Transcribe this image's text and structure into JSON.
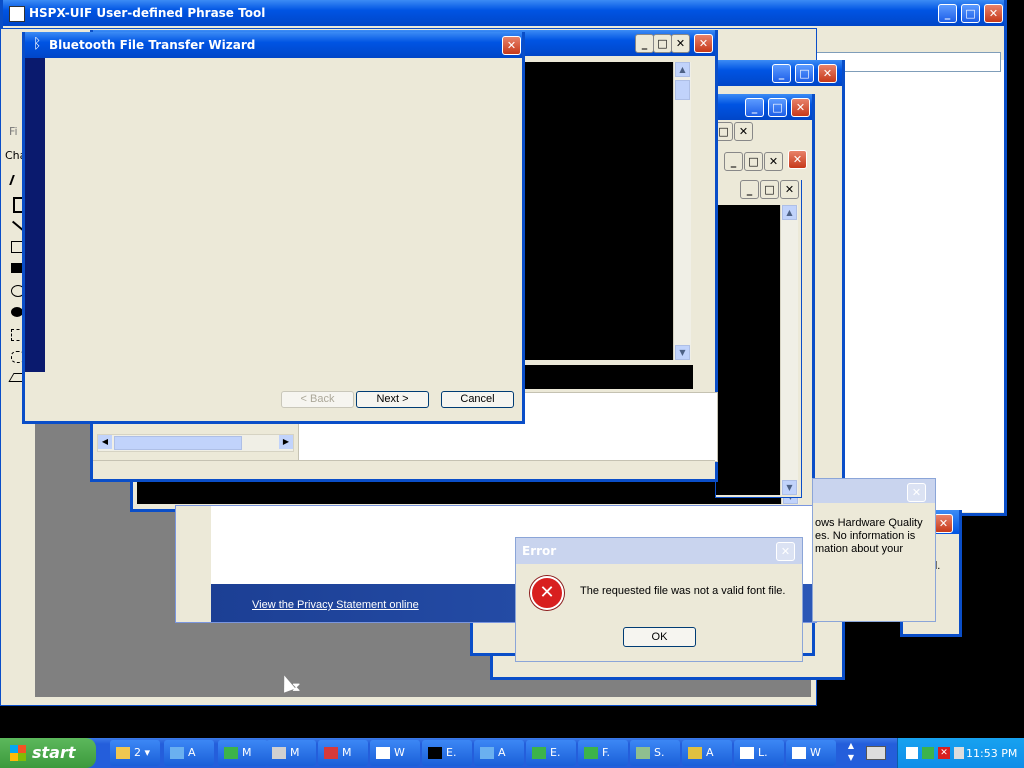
{
  "background_window": {
    "title": "HSPX-UIF User-defined Phrase Tool"
  },
  "paint_window": {
    "menu_fragment": "Fi",
    "char_label": "Cha"
  },
  "wizard": {
    "title": "Bluetooth File Transfer Wizard",
    "back_label": "< Back",
    "next_label": "Next >",
    "cancel_label": "Cancel"
  },
  "privacy": {
    "link_text": "View the Privacy Statement online"
  },
  "hardware_dialog": {
    "lines": [
      "ows Hardware Quality",
      "es.  No information is",
      "mation about your"
    ],
    "behind_line": "ed."
  },
  "error_dialog": {
    "title": "Error",
    "message": "The requested file  was not a valid font file.",
    "ok_label": "OK"
  },
  "taskbar": {
    "start_label": "start",
    "group_count": "2",
    "buttons": [
      "A",
      "M",
      "M",
      "M",
      "W",
      "E.",
      "A",
      "E.",
      "F.",
      "S.",
      "A",
      "L.",
      "W"
    ],
    "clock": "11:53 PM"
  },
  "colors": {
    "titlebar": "#0054e3",
    "dialog_face": "#ece9d8",
    "taskbar": "#245edb",
    "start_button": "#3c9a3c",
    "tray": "#0f8de8",
    "error_red": "#d81f1f"
  }
}
